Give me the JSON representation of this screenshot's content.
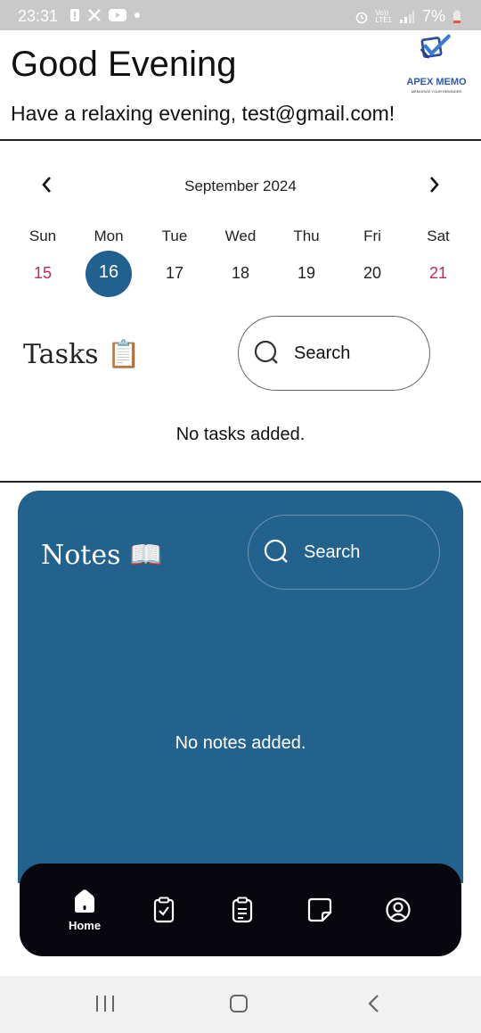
{
  "status_bar": {
    "time": "23:31",
    "battery": "7%",
    "network": "LTE",
    "icons": [
      "alert-icon",
      "x-logo-icon",
      "youtube-icon",
      "dot-icon",
      "alarm-icon",
      "volte-icon",
      "signal-icon",
      "battery-icon"
    ]
  },
  "header": {
    "greeting": "Good Evening",
    "subtitle": "Have a relaxing evening, test@gmail.com!",
    "logo_text": "APEX MEMO",
    "logo_tagline": "MEMORIZE YOUR REMINDER"
  },
  "calendar": {
    "month": "September 2024",
    "weekdays": [
      "Sun",
      "Mon",
      "Tue",
      "Wed",
      "Thu",
      "Fri",
      "Sat"
    ],
    "days": [
      "15",
      "16",
      "17",
      "18",
      "19",
      "20",
      "21"
    ],
    "selected_index": 1
  },
  "tasks": {
    "title": "Tasks 📋",
    "search_placeholder": "Search",
    "empty_text": "No tasks added."
  },
  "notes": {
    "title": "Notes 📖",
    "search_placeholder": "Search",
    "empty_text": "No notes added."
  },
  "bottom_nav": {
    "items": [
      {
        "icon": "home-icon",
        "label": "Home",
        "active": true
      },
      {
        "icon": "tasks-clipboard-icon",
        "label": "",
        "active": false
      },
      {
        "icon": "notes-clipboard-icon",
        "label": "",
        "active": false
      },
      {
        "icon": "note-page-icon",
        "label": "",
        "active": false
      },
      {
        "icon": "profile-icon",
        "label": "",
        "active": false
      }
    ]
  },
  "colors": {
    "accent": "#24628e",
    "weekend": "#c0285a",
    "nav_bg": "#07070d"
  }
}
